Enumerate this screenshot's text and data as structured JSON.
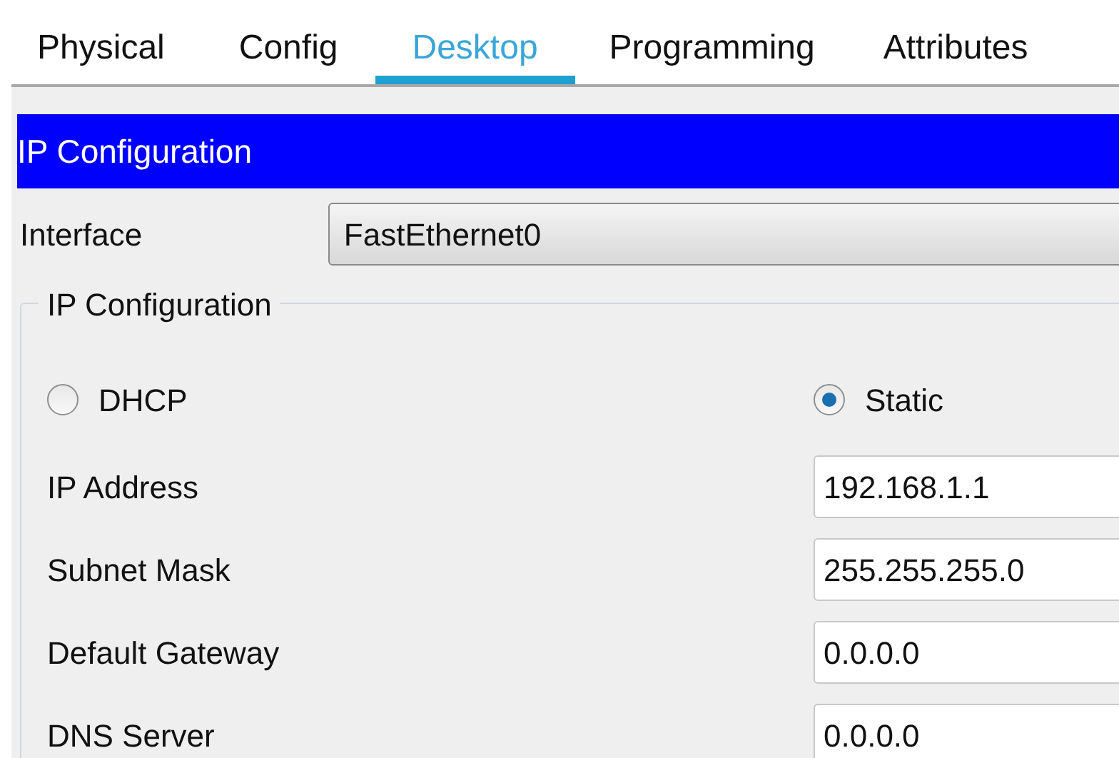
{
  "tabs": [
    {
      "label": "Physical",
      "selected": false
    },
    {
      "label": "Config",
      "selected": false
    },
    {
      "label": "Desktop",
      "selected": true
    },
    {
      "label": "Programming",
      "selected": false
    },
    {
      "label": "Attributes",
      "selected": false
    }
  ],
  "panel_title": "IP Configuration",
  "interface": {
    "label": "Interface",
    "value": "FastEthernet0"
  },
  "group": {
    "legend": "IP Configuration",
    "modes": [
      {
        "label": "DHCP",
        "selected": false
      },
      {
        "label": "Static",
        "selected": true
      }
    ],
    "fields": [
      {
        "label": "IP Address",
        "value": "192.168.1.1"
      },
      {
        "label": "Subnet Mask",
        "value": "255.255.255.0"
      },
      {
        "label": "Default Gateway",
        "value": "0.0.0.0"
      },
      {
        "label": "DNS Server",
        "value": "0.0.0.0"
      }
    ]
  }
}
